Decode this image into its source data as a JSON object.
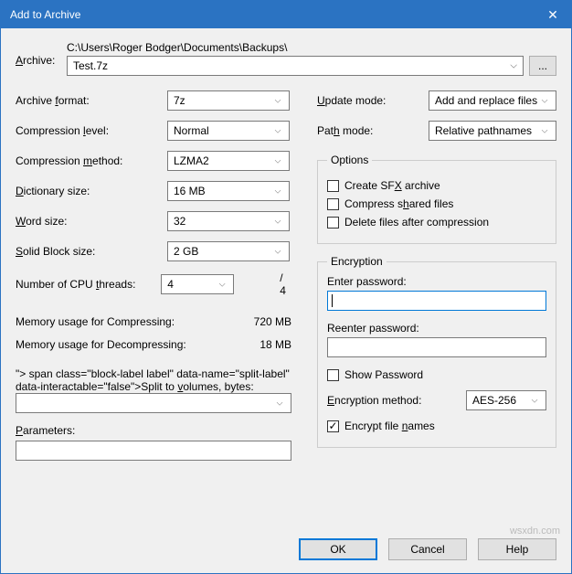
{
  "title": "Add to Archive",
  "archive_label": "Archive:",
  "archive_path": "C:\\Users\\Roger Bodger\\Documents\\Backups\\",
  "archive_name": "Test.7z",
  "browse": "...",
  "left": {
    "format_label_pre": "Archive ",
    "format_label_u": "f",
    "format_label_post": "ormat:",
    "format_value": "7z",
    "level_label_pre": "Compression ",
    "level_label_u": "l",
    "level_label_post": "evel:",
    "level_value": "Normal",
    "method_label_pre": "Compression ",
    "method_label_u": "m",
    "method_label_post": "ethod:",
    "method_value": "LZMA2",
    "dict_label_u": "D",
    "dict_label_post": "ictionary size:",
    "dict_value": "16 MB",
    "word_label_u": "W",
    "word_label_post": "ord size:",
    "word_value": "32",
    "solid_label_u": "S",
    "solid_label_post": "olid Block size:",
    "solid_value": "2 GB",
    "threads_label_pre": "Number of CPU ",
    "threads_label_u": "t",
    "threads_label_post": "hreads:",
    "threads_value": "4",
    "threads_total": "/ 4",
    "mem_compress_label": "Memory usage for Compressing:",
    "mem_compress_value": "720 MB",
    "mem_decompress_label": "Memory usage for Decompressing:",
    "mem_decompress_value": "18 MB",
    "split_label_pre": "Split to ",
    "split_label_u": "v",
    "split_label_post": "olumes, bytes:",
    "split_value": "",
    "params_label_u": "P",
    "params_label_post": "arameters:",
    "params_value": ""
  },
  "right": {
    "update_label_u": "U",
    "update_label_post": "pdate mode:",
    "update_value": "Add and replace files",
    "path_label_pre": "Pat",
    "path_label_u": "h",
    "path_label_post": " mode:",
    "path_value": "Relative pathnames",
    "options_legend": "Options",
    "opt_sfx_pre": "Create SF",
    "opt_sfx_u": "X",
    "opt_sfx_post": " archive",
    "opt_shared_pre": "Compress s",
    "opt_shared_u": "h",
    "opt_shared_post": "ared files",
    "opt_delete": "Delete files after compression",
    "enc_legend": "Encryption",
    "enc_pw1": "Enter password:",
    "enc_pw2": "Reenter password:",
    "show_pw": "Show Password",
    "enc_method_label_u": "E",
    "enc_method_label_post": "ncryption method:",
    "enc_method_value": "AES-256",
    "encrypt_names_pre": "Encrypt file ",
    "encrypt_names_u": "n",
    "encrypt_names_post": "ames"
  },
  "buttons": {
    "ok": "OK",
    "cancel": "Cancel",
    "help": "Help"
  },
  "watermark": "wsxdn.com",
  "checkmark": "✓"
}
